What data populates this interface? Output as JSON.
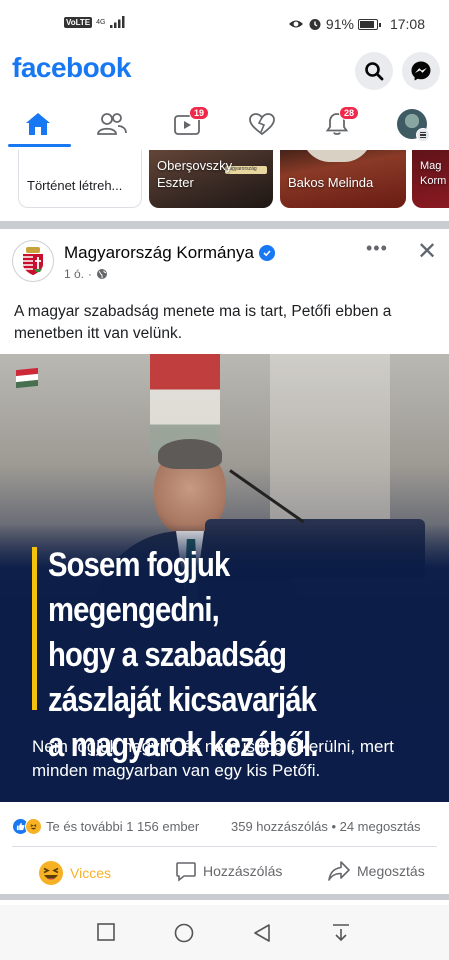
{
  "status_bar": {
    "volte": "VoLTE",
    "network": "4G",
    "battery": "91%",
    "time": "17:08"
  },
  "header": {
    "logo": "facebook",
    "search_icon": "search-icon",
    "messenger_icon": "messenger-icon"
  },
  "tabs": [
    {
      "name": "home-icon",
      "active": true
    },
    {
      "name": "friends-icon"
    },
    {
      "name": "watch-icon",
      "badge": "19"
    },
    {
      "name": "dating-icon"
    },
    {
      "name": "notifications-icon",
      "badge": "28"
    },
    {
      "name": "menu-avatar-icon"
    }
  ],
  "stories": {
    "create_label": "Történet létreh...",
    "items": [
      {
        "label_line1": "Oberşovszky",
        "label_line2": "Eszter"
      },
      {
        "label": "Bakos Melinda"
      },
      {
        "label_line1": "Mag",
        "label_line2": "Korm"
      }
    ],
    "sticker_text": "Magyarország"
  },
  "post": {
    "page_name": "Magyarország Kormánya",
    "time": "1 ó.",
    "text": "A magyar szabadság menete ma is tart, Petőfi ebben a menetben itt van velünk.",
    "image_headline_lines": [
      "Sosem fogjuk megengedni,",
      "hogy a szabadság",
      "zászlaját kicsavarják",
      "a magyarok kezéből."
    ],
    "image_subtext": "Nem fogjuk hagyni, és nem is fog sikerülni, mert minden magyarban van egy kis Petőfi.",
    "reactions_text": "Te és további 1 156 ember",
    "comments_shares": "359 hozzászólás  •  24 megosztás",
    "actions": {
      "react": "Vicces",
      "comment": "Hozzászólás",
      "share": "Megosztás"
    }
  },
  "colors": {
    "brand": "#1877f2",
    "react_active": "#f7b125",
    "badge": "#f02849"
  }
}
